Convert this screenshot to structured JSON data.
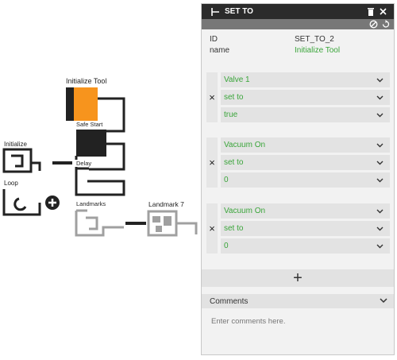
{
  "canvas": {
    "labels": {
      "initialize_tool": "Initialize Tool",
      "safe_start": "Safe Start",
      "delay": "Delay",
      "initialize": "Initialize",
      "loop": "Loop",
      "landmarks": "Landmarks",
      "landmark_7": "Landmark 7"
    },
    "colors": {
      "accent": "#f7941d",
      "block": "#222222",
      "disabled": "#a0a0a0"
    }
  },
  "panel": {
    "title": "SET TO",
    "icons": {
      "header_left": "flow-set-icon",
      "delete": "trash-icon",
      "close": "close-icon",
      "disable": "disable-icon",
      "reset": "undo-icon"
    },
    "properties": [
      {
        "key": "ID",
        "value": "SET_TO_2"
      },
      {
        "key": "name",
        "value": "Initialize Tool"
      }
    ],
    "groups": [
      {
        "target": "Valve 1",
        "operation": "set to",
        "value": "true"
      },
      {
        "target": "Vacuum On",
        "operation": "set to",
        "value": "0"
      },
      {
        "target": "Vacuum On",
        "operation": "set to",
        "value": "0"
      }
    ],
    "remove_symbol": "×",
    "add_symbol": "+",
    "comments": {
      "label": "Comments",
      "placeholder": "Enter comments here."
    },
    "colors": {
      "header": "#2b2b2b",
      "toolbar": "#777777",
      "value_text": "#3aa53a"
    }
  }
}
